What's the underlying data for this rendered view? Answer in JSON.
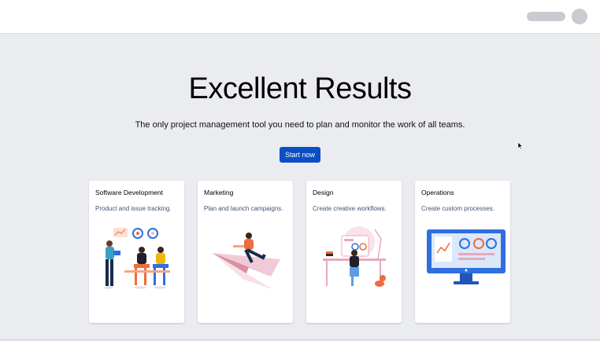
{
  "hero": {
    "title": "Excellent Results",
    "subtitle": "The only project management tool you need to plan and monitor the work of all teams.",
    "cta_label": "Start now"
  },
  "cards": [
    {
      "title": "Software Development",
      "description": "Product and issue tracking.",
      "illustration": "team-illustration"
    },
    {
      "title": "Marketing",
      "description": "Plan and launch campaigns.",
      "illustration": "paper-plane-illustration"
    },
    {
      "title": "Design",
      "description": "Create creative workflows.",
      "illustration": "designer-desk-illustration"
    },
    {
      "title": "Operations",
      "description": "Create custom processes.",
      "illustration": "monitor-dashboard-illustration"
    }
  ],
  "colors": {
    "page_bg": "#ebecf0",
    "primary_button": "#0b4fc4",
    "accent_blue": "#2f6fdf",
    "accent_orange": "#f06b3d"
  }
}
